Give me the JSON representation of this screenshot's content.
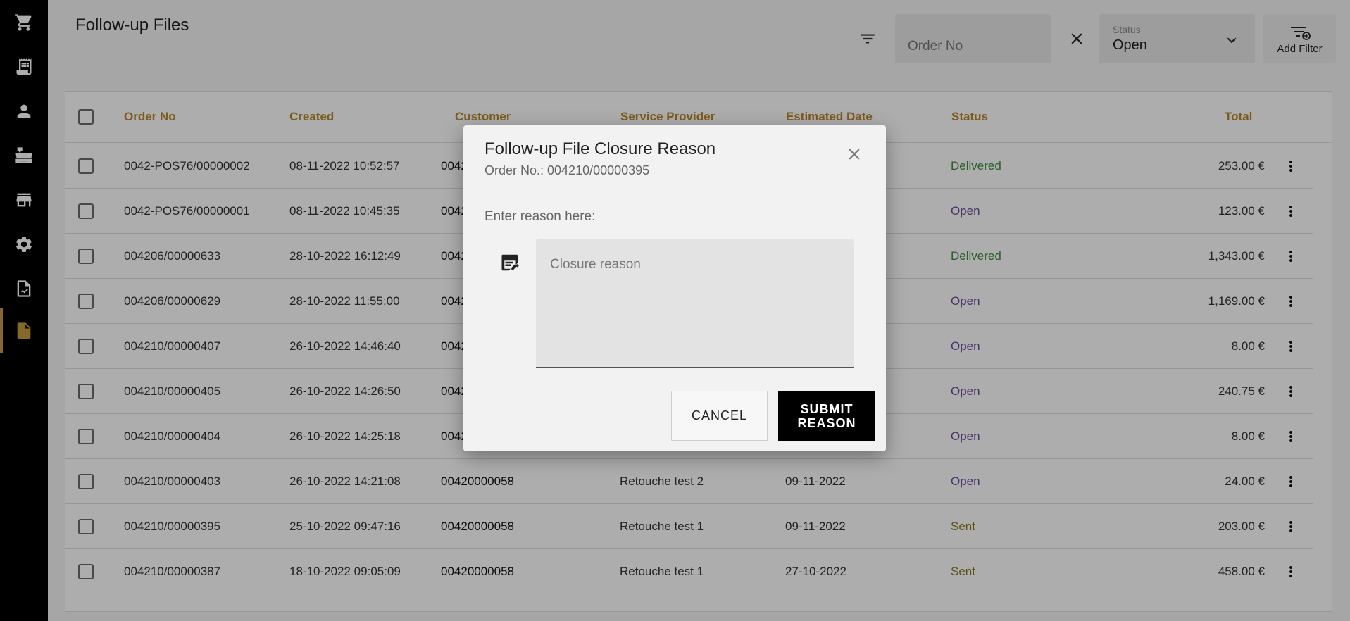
{
  "page": {
    "title": "Follow-up Files"
  },
  "sidebar": {
    "items": [
      {
        "icon": "cart-icon"
      },
      {
        "icon": "receipt-icon"
      },
      {
        "icon": "person-icon"
      },
      {
        "icon": "cash-register-icon"
      },
      {
        "icon": "store-icon"
      },
      {
        "icon": "gear-icon"
      },
      {
        "icon": "report-icon"
      },
      {
        "icon": "document-icon",
        "active": true
      }
    ]
  },
  "filters": {
    "order_no_placeholder": "Order No",
    "order_no_value": "",
    "status_label": "Status",
    "status_value": "Open",
    "add_filter_label": "Add Filter"
  },
  "table": {
    "columns": [
      "Order No",
      "Created",
      "Customer",
      "Service Provider",
      "Estimated Date",
      "Status",
      "Total"
    ],
    "rows": [
      {
        "order_no": "0042-POS76/00000002",
        "created": "08-11-2022 10:52:57",
        "customer": "0042",
        "provider": "",
        "est_date": "",
        "status": "Delivered",
        "total": "253.00 €"
      },
      {
        "order_no": "0042-POS76/00000001",
        "created": "08-11-2022 10:45:35",
        "customer": "0042",
        "provider": "",
        "est_date": "",
        "status": "Open",
        "total": "123.00 €"
      },
      {
        "order_no": "004206/00000633",
        "created": "28-10-2022 16:12:49",
        "customer": "0042",
        "provider": "",
        "est_date": "",
        "status": "Delivered",
        "total": "1,343.00 €"
      },
      {
        "order_no": "004206/00000629",
        "created": "28-10-2022 11:55:00",
        "customer": "0042",
        "provider": "",
        "est_date": "",
        "status": "Open",
        "total": "1,169.00 €"
      },
      {
        "order_no": "004210/00000407",
        "created": "26-10-2022 14:46:40",
        "customer": "0042",
        "provider": "",
        "est_date": "",
        "status": "Open",
        "total": "8.00 €"
      },
      {
        "order_no": "004210/00000405",
        "created": "26-10-2022 14:26:50",
        "customer": "0042",
        "provider": "",
        "est_date": "",
        "status": "Open",
        "total": "240.75 €"
      },
      {
        "order_no": "004210/00000404",
        "created": "26-10-2022 14:25:18",
        "customer": "0042",
        "provider": "",
        "est_date": "",
        "status": "Open",
        "total": "8.00 €"
      },
      {
        "order_no": "004210/00000403",
        "created": "26-10-2022 14:21:08",
        "customer": "00420000058",
        "provider": "Retouche test 2",
        "est_date": "09-11-2022",
        "status": "Open",
        "total": "24.00 €"
      },
      {
        "order_no": "004210/00000395",
        "created": "25-10-2022 09:47:16",
        "customer": "00420000058",
        "provider": "Retouche test 1",
        "est_date": "09-11-2022",
        "status": "Sent",
        "total": "203.00 €"
      },
      {
        "order_no": "004210/00000387",
        "created": "18-10-2022 09:05:09",
        "customer": "00420000058",
        "provider": "Retouche test 1",
        "est_date": "27-10-2022",
        "status": "Sent",
        "total": "458.00 €"
      }
    ]
  },
  "status_colors": {
    "Delivered": "#3d8b3d",
    "Open": "#6b4aa0",
    "Sent": "#8a7a1e"
  },
  "colors": {
    "accent": "#c69a3a",
    "sidebar_bg": "#000000"
  },
  "dialog": {
    "title": "Follow-up File Closure Reason",
    "subtitle": "Order No.: 004210/00000395",
    "reason_label": "Enter reason here:",
    "reason_placeholder": "Closure reason",
    "reason_value": "",
    "cancel_label": "CANCEL",
    "submit_label": "SUBMIT REASON"
  }
}
